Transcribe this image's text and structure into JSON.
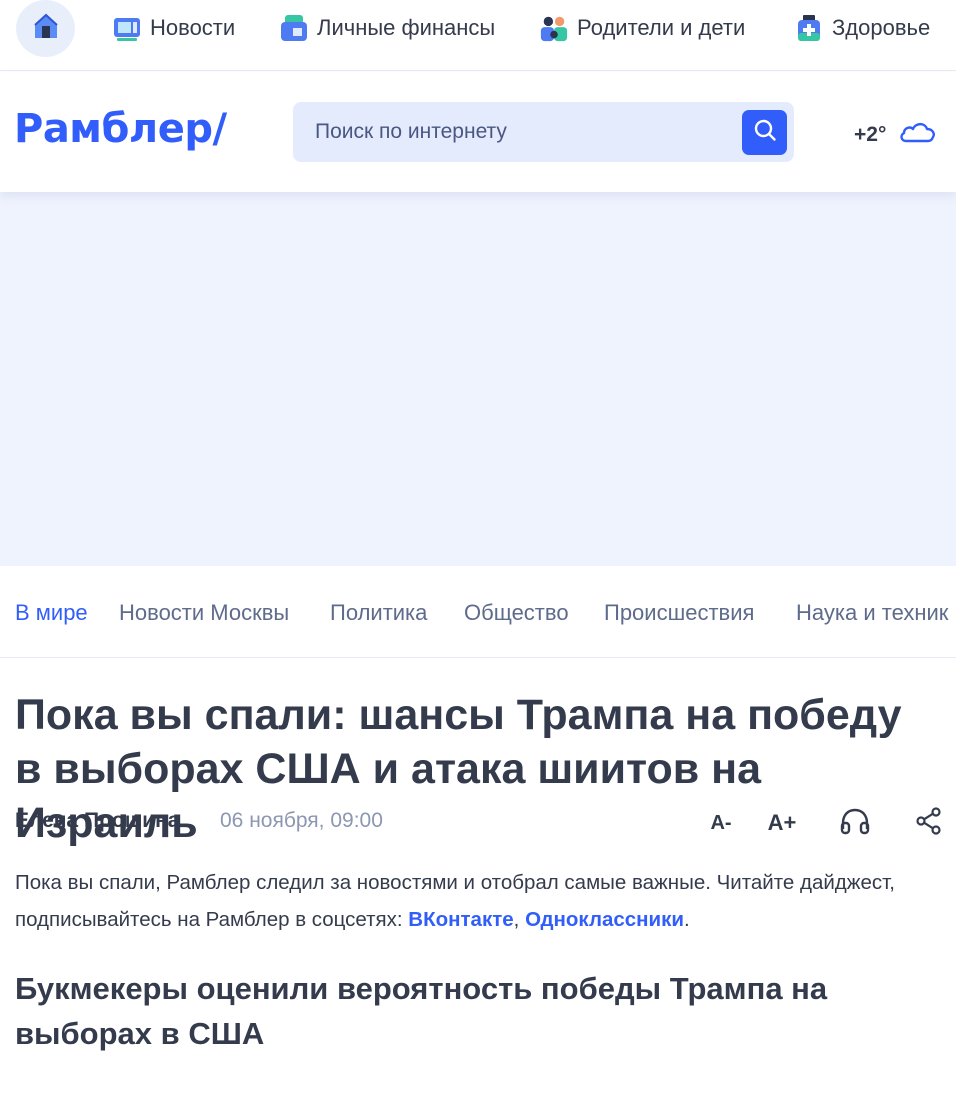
{
  "topbar": {
    "items": [
      {
        "label": "Новости",
        "icon": "news-icon"
      },
      {
        "label": "Личные финансы",
        "icon": "finance-icon"
      },
      {
        "label": "Родители и дети",
        "icon": "family-icon"
      },
      {
        "label": "Здоровье",
        "icon": "health-icon"
      }
    ]
  },
  "header": {
    "logo": "Рамблер/",
    "search_placeholder": "Поиск по интернету",
    "weather_temp": "+2°",
    "weather_icon": "cloud-icon"
  },
  "rubrics": [
    "В мире",
    "Новости Москвы",
    "Политика",
    "Общество",
    "Происшествия",
    "Наука и техник"
  ],
  "article": {
    "title_line1": "Пока вы спали: шансы Трампа на победу",
    "title_line2": "в выборах США и атака шиитов на Израиль",
    "author": "Елена Прошина",
    "date": "06 ноября, 09:00",
    "tools": {
      "font_decrease": "A-",
      "font_increase": "A+"
    },
    "lead_text": "Пока вы спали, Рамблер следил за новостями и отобрал самые важные. Читайте дайджест, подписывайтесь на Рамблер в соцсетях: ",
    "lead_link_vk": "ВКонтакте",
    "lead_sep": ", ",
    "lead_link_ok": "Одноклассники",
    "lead_end": ".",
    "subtitle": "Букмекеры оценили вероятность победы Трампа на выборах в США"
  },
  "colors": {
    "accent": "#315efb",
    "text": "#343b4c",
    "muted": "#8d96b2",
    "ad_bg": "#eff3fd"
  }
}
